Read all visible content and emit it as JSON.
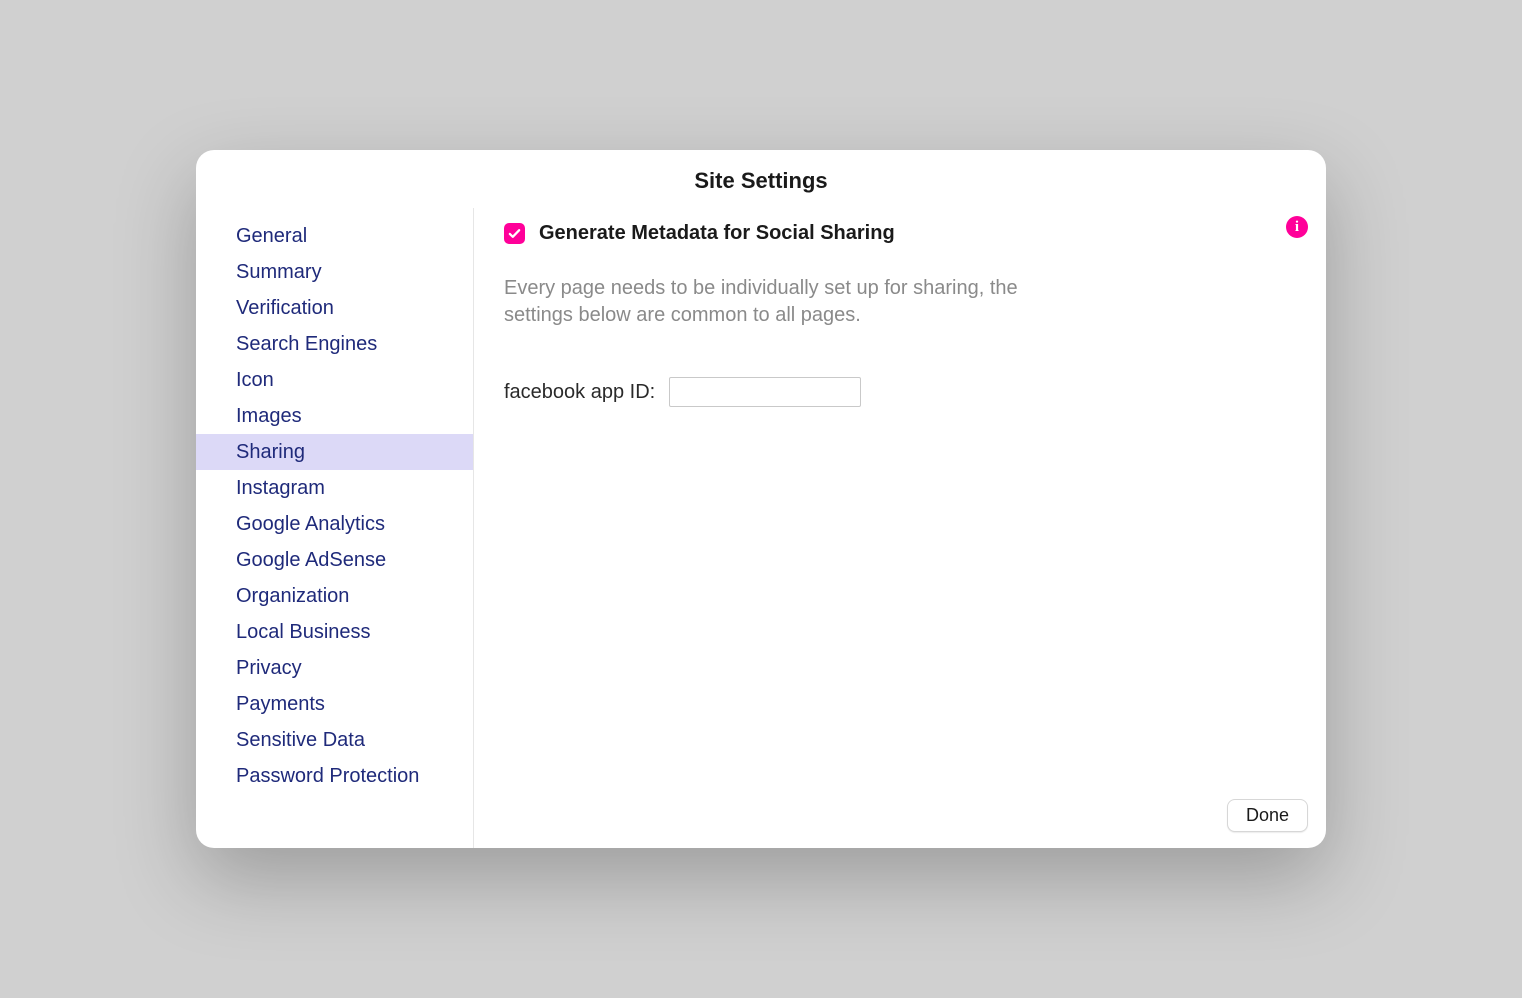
{
  "dialog": {
    "title": "Site Settings"
  },
  "sidebar": {
    "items": [
      {
        "label": "General",
        "selected": false
      },
      {
        "label": "Summary",
        "selected": false
      },
      {
        "label": "Verification",
        "selected": false
      },
      {
        "label": "Search Engines",
        "selected": false
      },
      {
        "label": "Icon",
        "selected": false
      },
      {
        "label": "Images",
        "selected": false
      },
      {
        "label": "Sharing",
        "selected": true
      },
      {
        "label": "Instagram",
        "selected": false
      },
      {
        "label": "Google Analytics",
        "selected": false
      },
      {
        "label": "Google AdSense",
        "selected": false
      },
      {
        "label": "Organization",
        "selected": false
      },
      {
        "label": "Local Business",
        "selected": false
      },
      {
        "label": "Privacy",
        "selected": false
      },
      {
        "label": "Payments",
        "selected": false
      },
      {
        "label": "Sensitive Data",
        "selected": false
      },
      {
        "label": "Password Protection",
        "selected": false
      }
    ]
  },
  "content": {
    "checkbox_checked": true,
    "checkbox_label": "Generate Metadata for Social Sharing",
    "description": "Every page needs to be individually set up for sharing, the settings below are common to all pages.",
    "field_label": "facebook app ID:",
    "field_value": ""
  },
  "buttons": {
    "done": "Done"
  },
  "colors": {
    "accent": "#ff0099",
    "sidebar_text": "#1f2a7a",
    "selected_bg": "#dcd9f7"
  }
}
